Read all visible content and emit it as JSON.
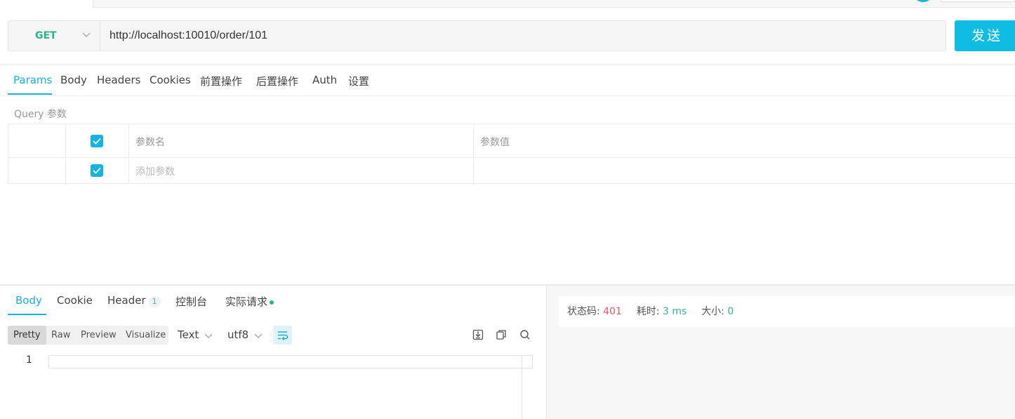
{
  "request": {
    "method": "GET",
    "url": "http://localhost:10010/order/101",
    "send_label": "发送"
  },
  "request_tabs": [
    {
      "label": "Params",
      "active": true
    },
    {
      "label": "Body"
    },
    {
      "label": "Headers"
    },
    {
      "label": "Cookies"
    },
    {
      "label": "前置操作"
    },
    {
      "label": "后置操作"
    },
    {
      "label": "Auth"
    },
    {
      "label": "设置"
    }
  ],
  "params": {
    "section_label": "Query 参数",
    "header_name": "参数名",
    "header_value": "参数值",
    "add_placeholder": "添加参数",
    "header_checked": true,
    "add_row_checked": true
  },
  "response_tabs": [
    {
      "label": "Body",
      "active": true
    },
    {
      "label": "Cookie"
    },
    {
      "label": "Header",
      "badge": "1"
    },
    {
      "label": "控制台"
    },
    {
      "label": "实际请求",
      "dot": true
    }
  ],
  "format_buttons": [
    {
      "label": "Pretty",
      "active": true
    },
    {
      "label": "Raw"
    },
    {
      "label": "Preview"
    },
    {
      "label": "Visualize"
    }
  ],
  "content_type": "Text",
  "encoding": "utf8",
  "editor": {
    "line_numbers": [
      "1"
    ]
  },
  "status": {
    "status_label": "状态码:",
    "status_value": "401",
    "time_label": "耗时:",
    "time_value": "3 ms",
    "size_label": "大小:",
    "size_value": "0"
  },
  "colors": {
    "accent": "#15b3dc",
    "method_get": "#28b58a",
    "status_error": "#e25b5b",
    "metric_ok": "#36b689"
  },
  "icons": [
    "chevron-down-icon",
    "check-icon",
    "wrap-lines-icon",
    "download-icon",
    "copy-icon",
    "search-icon"
  ]
}
